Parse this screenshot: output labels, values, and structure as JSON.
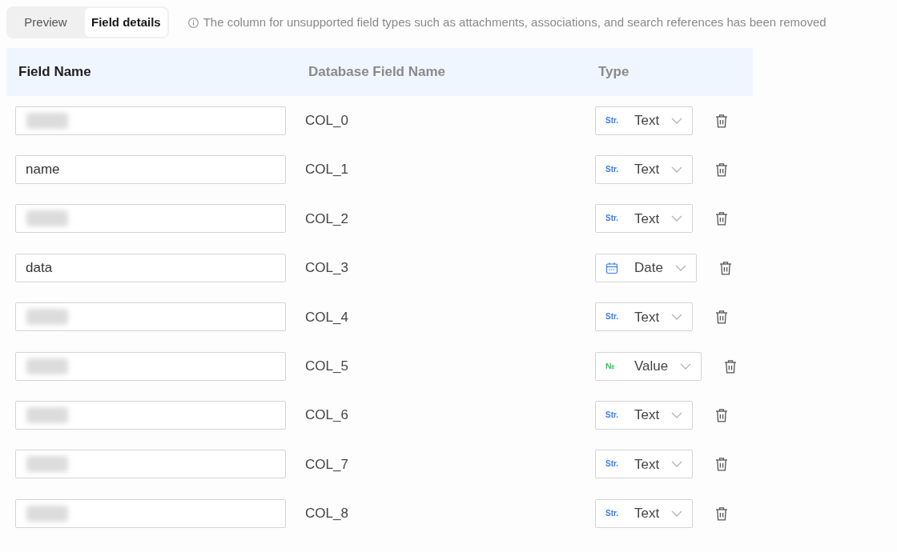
{
  "tabs": [
    {
      "label": "Preview",
      "selected": false
    },
    {
      "label": "Field details",
      "selected": true
    }
  ],
  "notice": {
    "text": "The column for unsupported field types such as attachments, associations, and search references has been removed"
  },
  "table": {
    "columns": [
      {
        "label": "Field Name",
        "highlighted": true
      },
      {
        "label": "Database Field Name",
        "highlighted": false
      },
      {
        "label": "Type",
        "highlighted": false
      }
    ],
    "rows": [
      {
        "field_name_redacted": true,
        "db_name": "COL_0",
        "type": {
          "kind": "string",
          "icon_text": "Str.",
          "label": "Text"
        }
      },
      {
        "field_name": "name",
        "db_name": "COL_1",
        "type": {
          "kind": "string",
          "icon_text": "Str.",
          "label": "Text"
        }
      },
      {
        "field_name_redacted": true,
        "db_name": "COL_2",
        "type": {
          "kind": "string",
          "icon_text": "Str.",
          "label": "Text"
        }
      },
      {
        "field_name": "data",
        "db_name": "COL_3",
        "type": {
          "kind": "date",
          "label": "Date"
        }
      },
      {
        "field_name_redacted": true,
        "db_name": "COL_4",
        "type": {
          "kind": "string",
          "icon_text": "Str.",
          "label": "Text"
        }
      },
      {
        "field_name_redacted": true,
        "db_name": "COL_5",
        "type": {
          "kind": "number",
          "icon_text": "№",
          "label": "Value"
        }
      },
      {
        "field_name_redacted": true,
        "db_name": "COL_6",
        "type": {
          "kind": "string",
          "icon_text": "Str.",
          "label": "Text"
        }
      },
      {
        "field_name_redacted": true,
        "db_name": "COL_7",
        "type": {
          "kind": "string",
          "icon_text": "Str.",
          "label": "Text"
        }
      },
      {
        "field_name_redacted": true,
        "db_name": "COL_8",
        "type": {
          "kind": "string",
          "icon_text": "Str.",
          "label": "Text"
        }
      }
    ]
  }
}
